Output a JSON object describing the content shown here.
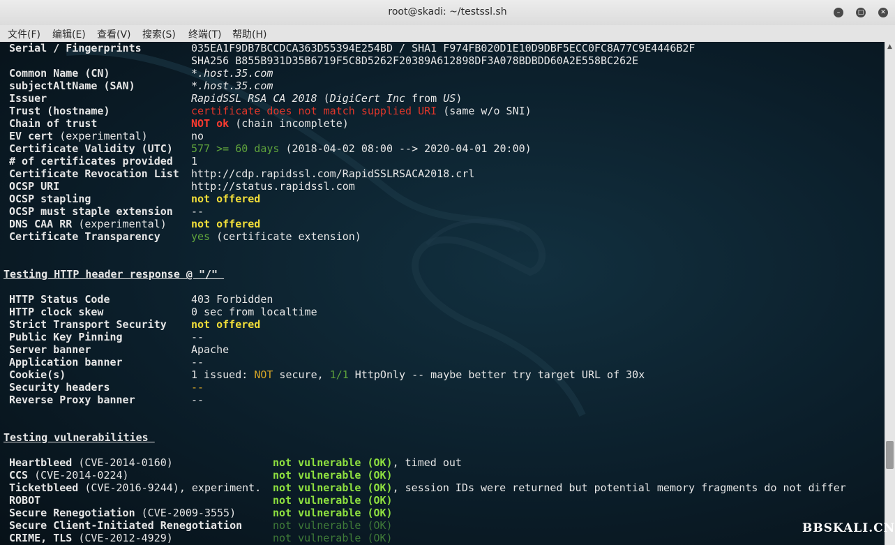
{
  "window": {
    "title": "root@skadi: ~/testssl.sh"
  },
  "menu": [
    "文件(F)",
    "编辑(E)",
    "查看(V)",
    "搜索(S)",
    "终端(T)",
    "帮助(H)"
  ],
  "cert": {
    "serial_label": "Serial / Fingerprints",
    "serial_val1": "035EA1F9DB7BCCDCA363D55394E254BD / SHA1 F974FB020D1E10D9DBF5ECC0FC8A77C9E4446B2F",
    "serial_val2": "SHA256 B855B931D35B6719F5C8D5262F20389A612898DF3A078BDBDD60A2E558BC262E",
    "cn_label": "Common Name (CN)",
    "cn_val": "*.host.35.com",
    "san_label": "subjectAltName (SAN)",
    "san_val": "*.host.35.com",
    "issuer_label": "Issuer",
    "issuer_ca": "RapidSSL RSA CA 2018",
    "issuer_paren_open": " (",
    "issuer_org": "DigiCert Inc",
    "issuer_from": " from ",
    "issuer_country": "US",
    "issuer_paren_close": ")",
    "trust_label": "Trust (hostname)",
    "trust_warn": "certificate does not match supplied URI",
    "trust_note": " (same w/o SNI)",
    "chain_label": "Chain of trust",
    "chain_warn": "NOT ok",
    "chain_note": " (chain incomplete)",
    "ev_label": "EV cert",
    "ev_label_note": " (experimental)",
    "ev_val": "no",
    "validity_label": "Certificate Validity (UTC)",
    "validity_ok": "577 >= 60 days",
    "validity_range": " (2018-04-02 08:00 --> 2020-04-01 20:00)",
    "count_label": "# of certificates provided",
    "count_val": "1",
    "crl_label": "Certificate Revocation List",
    "crl_val": "http://cdp.rapidssl.com/RapidSSLRSACA2018.crl",
    "ocsp_label": "OCSP URI",
    "ocsp_val": "http://status.rapidssl.com",
    "stapling_label": "OCSP stapling",
    "stapling_val": "not offered",
    "muststaple_label": "OCSP must staple extension",
    "muststaple_val": "--",
    "caa_label": "DNS CAA RR",
    "caa_label_note": " (experimental)",
    "caa_val": "not offered",
    "ct_label": "Certificate Transparency",
    "ct_ok": "yes",
    "ct_note": " (certificate extension)"
  },
  "http": {
    "header": "Testing HTTP header response @ \"/\" ",
    "status_label": "HTTP Status Code",
    "status_val": "403 Forbidden",
    "skew_label": "HTTP clock skew",
    "skew_val": "0 sec from localtime",
    "hsts_label": "Strict Transport Security",
    "hsts_val": "not offered",
    "hpkp_label": "Public Key Pinning",
    "hpkp_val": "--",
    "server_label": "Server banner",
    "server_val": "Apache",
    "app_label": "Application banner",
    "app_val": "--",
    "cookie_label": "Cookie(s)",
    "cookie_a": "1 issued: ",
    "cookie_not": "NOT",
    "cookie_b": " secure, ",
    "cookie_frac": "1/1",
    "cookie_c": " HttpOnly -- maybe better try target URL of 30x",
    "sechdr_label": "Security headers",
    "sechdr_val": "--",
    "proxy_label": "Reverse Proxy banner",
    "proxy_val": "--"
  },
  "vuln": {
    "header": "Testing vulnerabilities ",
    "hb_label": "Heartbleed",
    "hb_cve": " (CVE-2014-0160)",
    "hb_ok": "not vulnerable (OK)",
    "hb_note": ", timed out",
    "ccs_label": "CCS",
    "ccs_cve": " (CVE-2014-0224)",
    "ccs_ok": "not vulnerable (OK)",
    "tb_label": "Ticketbleed",
    "tb_cve": " (CVE-2016-9244), experiment.",
    "tb_ok": "not vulnerable (OK)",
    "tb_note": ", session IDs were returned but potential memory fragments do not differ",
    "robot_label": "ROBOT",
    "robot_ok": "not vulnerable (OK)",
    "reneg_label": "Secure Renegotiation",
    "reneg_cve": " (CVE-2009-3555)",
    "reneg_ok": "not vulnerable (OK)",
    "cireneg_label": "Secure Client-Initiated Renegotiation",
    "cireneg_ok": "not vulnerable (OK)",
    "crime_label": "CRIME, TLS",
    "crime_cve": " (CVE-2012-4929)",
    "crime_ok": "not vulnerable (OK)"
  },
  "watermark": "BBSKALI.CN"
}
